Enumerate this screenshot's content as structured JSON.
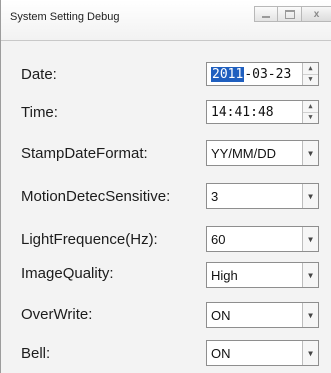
{
  "window": {
    "title": "System Setting Debug",
    "controls": {
      "minimize": "—",
      "maximize": "□",
      "close": "x"
    }
  },
  "fields": {
    "date": {
      "label": "Date:",
      "value_selected": "2011",
      "value_rest": "-03-23"
    },
    "time": {
      "label": "Time:",
      "value": "14:41:48"
    },
    "stamp_date_format": {
      "label": "StampDateFormat:",
      "value": "YY/MM/DD"
    },
    "motion_detec_sensitive": {
      "label": "MotionDetecSensitive:",
      "value": "3"
    },
    "light_frequence": {
      "label": "LightFrequence(Hz):",
      "value": "60"
    },
    "image_quality": {
      "label": "ImageQuality:",
      "value": "High"
    },
    "over_write": {
      "label": "OverWrite:",
      "value": "ON"
    },
    "bell": {
      "label": "Bell:",
      "value": "ON"
    }
  },
  "icons": {
    "spin_up": "▲",
    "spin_down": "▼",
    "dropdown": "▼"
  }
}
